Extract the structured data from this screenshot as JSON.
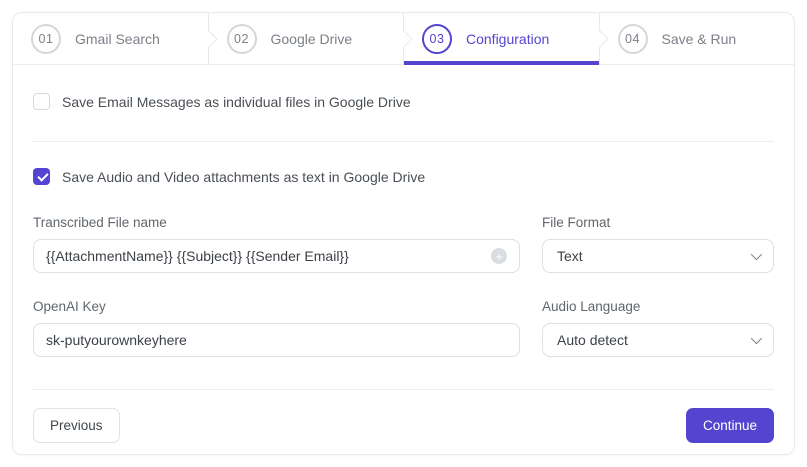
{
  "colors": {
    "accent": "#5445d0"
  },
  "stepper": {
    "steps": [
      {
        "num": "01",
        "label": "Gmail Search",
        "active": false
      },
      {
        "num": "02",
        "label": "Google Drive",
        "active": false
      },
      {
        "num": "03",
        "label": "Configuration",
        "active": true
      },
      {
        "num": "04",
        "label": "Save & Run",
        "active": false
      }
    ]
  },
  "options": {
    "save_email": {
      "label": "Save Email Messages as individual files in Google Drive",
      "checked": false
    },
    "save_audio": {
      "label": "Save Audio and Video attachments as text in Google Drive",
      "checked": true
    }
  },
  "form": {
    "transcribed_file_name": {
      "label": "Transcribed File name",
      "value": "{{AttachmentName}} {{Subject}} {{Sender Email}}",
      "add_icon": "+"
    },
    "file_format": {
      "label": "File Format",
      "value": "Text"
    },
    "openai_key": {
      "label": "OpenAI Key",
      "value": "sk-putyourownkeyhere"
    },
    "audio_language": {
      "label": "Audio Language",
      "value": "Auto detect"
    }
  },
  "footer": {
    "previous_label": "Previous",
    "continue_label": "Continue"
  }
}
